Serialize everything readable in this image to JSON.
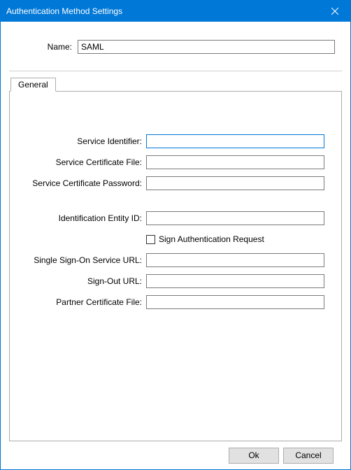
{
  "window": {
    "title": "Authentication Method Settings"
  },
  "name": {
    "label": "Name:",
    "value": "SAML"
  },
  "tabs": {
    "general": "General"
  },
  "form": {
    "service_identifier": {
      "label": "Service Identifier:",
      "value": ""
    },
    "service_cert_file": {
      "label": "Service Certificate File:",
      "value": ""
    },
    "service_cert_password": {
      "label": "Service Certificate Password:",
      "value": ""
    },
    "identification_entity_id": {
      "label": "Identification Entity ID:",
      "value": ""
    },
    "sign_auth_request": {
      "label": "Sign Authentication Request",
      "checked": false
    },
    "sso_service_url": {
      "label": "Single Sign-On Service URL:",
      "value": ""
    },
    "signout_url": {
      "label": "Sign-Out URL:",
      "value": ""
    },
    "partner_cert_file": {
      "label": "Partner Certificate File:",
      "value": ""
    }
  },
  "buttons": {
    "ok": "Ok",
    "cancel": "Cancel"
  }
}
